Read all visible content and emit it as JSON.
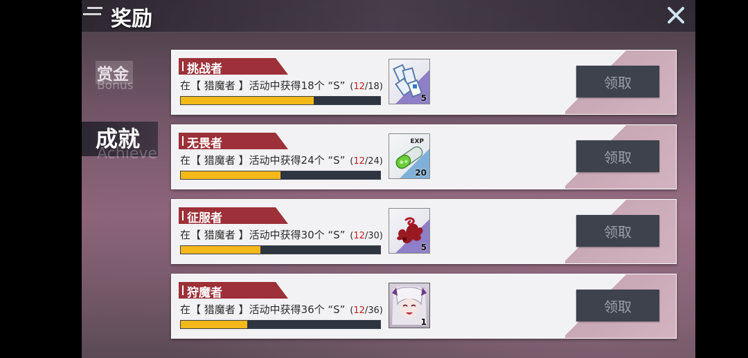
{
  "header": {
    "title": "奖励"
  },
  "sidebar": {
    "tabs": [
      {
        "label": "赏金",
        "sub": "Bonus"
      },
      {
        "label": "成就",
        "sub": "Achieve"
      }
    ]
  },
  "achievements": [
    {
      "name": "挑战者",
      "desc": "在【 猎魔者 】活动中获得18个 “S”",
      "open": "(",
      "current": "12",
      "target": "/18)",
      "progress": 0.667,
      "icon": "tickets-icon",
      "qty": "5",
      "button": "领取"
    },
    {
      "name": "无畏者",
      "desc": "在【 猎魔者 】活动中获得24个 “S”",
      "open": "(",
      "current": "12",
      "target": "/24)",
      "progress": 0.5,
      "icon": "exp-capsule-icon",
      "qty": "20",
      "button": "领取",
      "icon_text": "EXP"
    },
    {
      "name": "征服者",
      "desc": "在【 猎魔者 】活动中获得30个 “S”",
      "open": "(",
      "current": "12",
      "target": "/30)",
      "progress": 0.4,
      "icon": "blood-splash-icon",
      "qty": "5",
      "button": "领取"
    },
    {
      "name": "狩魔者",
      "desc": "在【 猎魔者 】活动中获得36个 “S”",
      "open": "(",
      "current": "12",
      "target": "/36)",
      "progress": 0.333,
      "icon": "character-portrait-icon",
      "qty": "1",
      "button": "领取"
    }
  ],
  "colors": {
    "ribbon": "#9d3038",
    "progress_fill": "#f4b818",
    "progress_track": "#2e3440",
    "button_bg": "#3d424c"
  }
}
